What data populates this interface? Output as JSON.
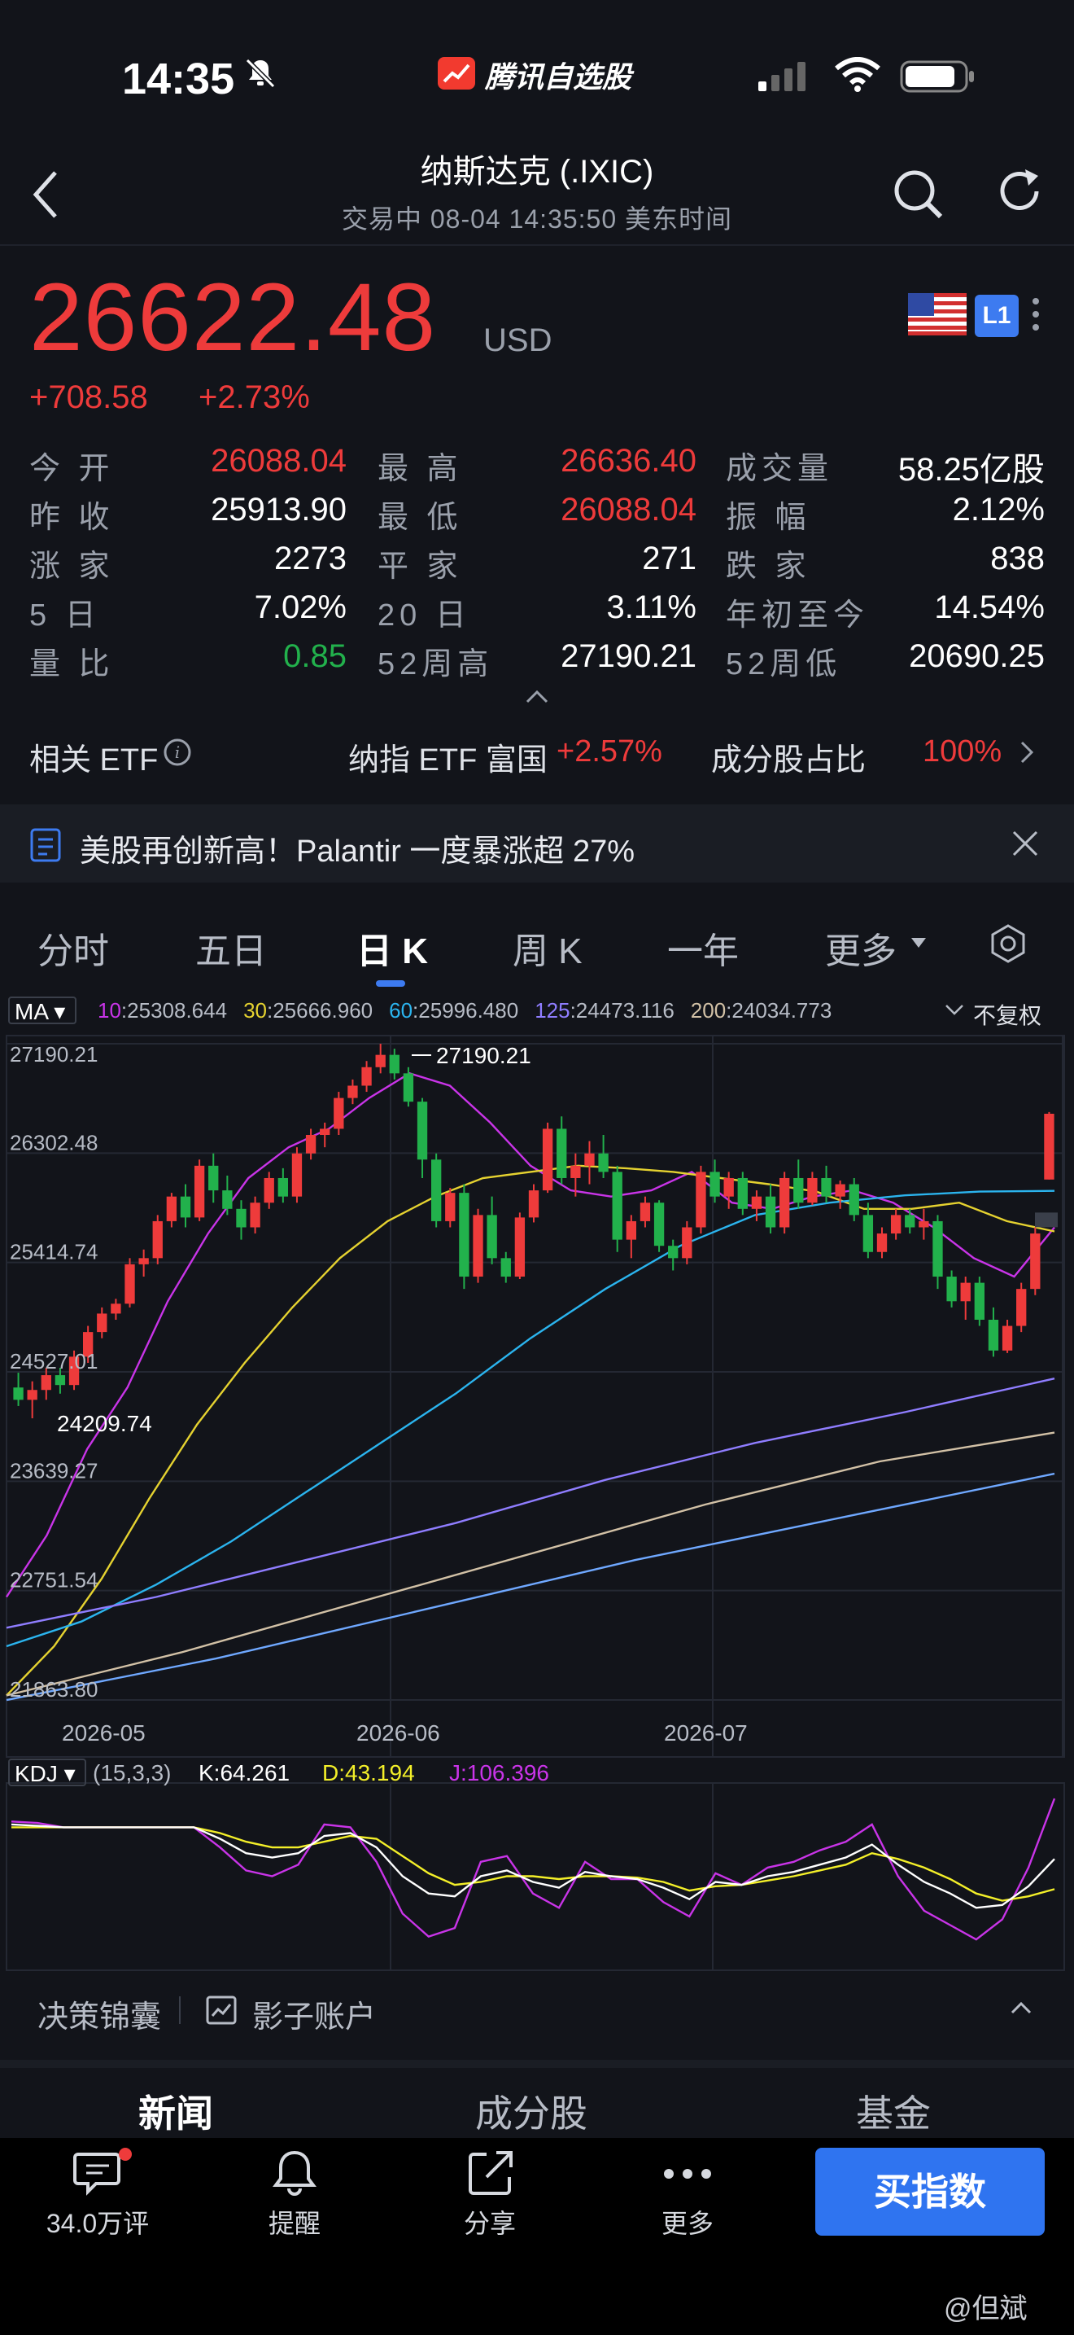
{
  "status_bar": {
    "time": "14:35",
    "app_name": "腾讯自选股"
  },
  "header": {
    "title": "纳斯达克 (.IXIC)",
    "subtitle": "交易中  08-04 14:35:50 美东时间"
  },
  "quote": {
    "price": "26622.48",
    "currency": "USD",
    "change": "+708.58",
    "change_pct": "+2.73%",
    "level_badge": "L1",
    "up_color": "#ee3b3b",
    "down_color": "#22b14c"
  },
  "stats": [
    [
      {
        "label": "今 开",
        "value": "26088.04",
        "color": "red"
      },
      {
        "label": "最 高",
        "value": "26636.40",
        "color": "red"
      },
      {
        "label": "成交量",
        "value": "58.25亿股",
        "color": "white"
      }
    ],
    [
      {
        "label": "昨 收",
        "value": "25913.90",
        "color": "white"
      },
      {
        "label": "最 低",
        "value": "26088.04",
        "color": "red"
      },
      {
        "label": "振 幅",
        "value": "2.12%",
        "color": "white"
      }
    ],
    [
      {
        "label": "涨 家",
        "value": "2273",
        "color": "white"
      },
      {
        "label": "平 家",
        "value": "271",
        "color": "white"
      },
      {
        "label": "跌 家",
        "value": "838",
        "color": "white"
      }
    ],
    [
      {
        "label": "5 日",
        "value": "7.02%",
        "color": "white"
      },
      {
        "label": "20 日",
        "value": "3.11%",
        "color": "white"
      },
      {
        "label": "年初至今",
        "value": "14.54%",
        "color": "white"
      }
    ],
    [
      {
        "label": "量 比",
        "value": "0.85",
        "color": "green"
      },
      {
        "label": "52周高",
        "value": "27190.21",
        "color": "white"
      },
      {
        "label": "52周低",
        "value": "20690.25",
        "color": "white"
      }
    ]
  ],
  "etf": {
    "label": "相关 ETF",
    "fund": "纳指 ETF 富国",
    "fund_change": "+2.57%",
    "component_label": "成分股占比",
    "component_value": "100%"
  },
  "news_banner": {
    "text": "美股再创新高！Palantir 一度暴涨超 27%"
  },
  "tabs": [
    "分时",
    "五日",
    "日 K",
    "周 K",
    "一年",
    "更多"
  ],
  "active_tab": 2,
  "ma_bar": {
    "button": "MA",
    "items": [
      {
        "label": "10",
        "value": "25308.644",
        "color": "#c934e8"
      },
      {
        "label": "30",
        "value": "25666.960",
        "color": "#e5d230"
      },
      {
        "label": "60",
        "value": "25996.480",
        "color": "#2bb4ee"
      },
      {
        "label": "125",
        "value": "24473.116",
        "color": "#8f7dff"
      },
      {
        "label": "200",
        "value": "24034.773",
        "color": "#d2c1a6"
      }
    ],
    "adjust": "不复权"
  },
  "chart_data": {
    "type": "candlestick",
    "y_ticks": [
      "27190.21",
      "26302.48",
      "25414.74",
      "24527.01",
      "23639.27",
      "22751.54",
      "21863.80"
    ],
    "ylim": [
      21863.8,
      27190.21
    ],
    "x_ticks": [
      "2026-05",
      "2026-06",
      "2026-07"
    ],
    "annotations": [
      {
        "label": "27190.21"
      },
      {
        "label": "24209.74"
      }
    ],
    "candles": [
      [
        24400,
        24520,
        24250,
        24300
      ],
      [
        24300,
        24450,
        24150,
        24380
      ],
      [
        24380,
        24560,
        24300,
        24500
      ],
      [
        24500,
        24560,
        24350,
        24420
      ],
      [
        24420,
        24700,
        24380,
        24650
      ],
      [
        24650,
        24900,
        24600,
        24850
      ],
      [
        24850,
        25050,
        24800,
        25000
      ],
      [
        25000,
        25120,
        24950,
        25080
      ],
      [
        25080,
        25450,
        25050,
        25400
      ],
      [
        25400,
        25520,
        25300,
        25450
      ],
      [
        25450,
        25800,
        25400,
        25750
      ],
      [
        25750,
        25980,
        25700,
        25950
      ],
      [
        25950,
        26050,
        25700,
        25780
      ],
      [
        25780,
        26250,
        25750,
        26200
      ],
      [
        26200,
        26300,
        25900,
        26000
      ],
      [
        26000,
        26120,
        25800,
        25850
      ],
      [
        25850,
        25920,
        25600,
        25700
      ],
      [
        25700,
        25950,
        25650,
        25900
      ],
      [
        25900,
        26150,
        25850,
        26100
      ],
      [
        26100,
        26180,
        25900,
        25950
      ],
      [
        25950,
        26350,
        25900,
        26300
      ],
      [
        26300,
        26500,
        26250,
        26450
      ],
      [
        26450,
        26550,
        26350,
        26500
      ],
      [
        26500,
        26800,
        26450,
        26750
      ],
      [
        26750,
        26900,
        26700,
        26850
      ],
      [
        26850,
        27050,
        26800,
        27000
      ],
      [
        27000,
        27190,
        26950,
        27100
      ],
      [
        27100,
        27150,
        26900,
        26950
      ],
      [
        26950,
        27000,
        26680,
        26720
      ],
      [
        26720,
        26750,
        26100,
        26250
      ],
      [
        26250,
        26300,
        25700,
        25750
      ],
      [
        25750,
        26020,
        25700,
        25980
      ],
      [
        25980,
        26050,
        25200,
        25300
      ],
      [
        25300,
        25850,
        25250,
        25800
      ],
      [
        25800,
        25950,
        25400,
        25450
      ],
      [
        25450,
        25500,
        25250,
        25300
      ],
      [
        25300,
        25820,
        25280,
        25780
      ],
      [
        25780,
        26050,
        25740,
        26000
      ],
      [
        26000,
        26550,
        25980,
        26500
      ],
      [
        26500,
        26600,
        26050,
        26100
      ],
      [
        26100,
        26300,
        25950,
        26200
      ],
      [
        26200,
        26400,
        26050,
        26300
      ],
      [
        26300,
        26450,
        26100,
        26150
      ],
      [
        26150,
        26200,
        25500,
        25600
      ],
      [
        25600,
        25800,
        25450,
        25750
      ],
      [
        25750,
        25950,
        25700,
        25900
      ],
      [
        25900,
        25920,
        25500,
        25550
      ],
      [
        25550,
        25600,
        25350,
        25450
      ],
      [
        25450,
        25750,
        25400,
        25700
      ],
      [
        25700,
        26200,
        25650,
        26150
      ],
      [
        26150,
        26250,
        25900,
        25950
      ],
      [
        25950,
        26150,
        25850,
        26100
      ],
      [
        26100,
        26150,
        25800,
        25850
      ],
      [
        25850,
        26000,
        25750,
        25950
      ],
      [
        25950,
        26050,
        25650,
        25700
      ],
      [
        25700,
        26150,
        25650,
        26100
      ],
      [
        26100,
        26250,
        25850,
        25900
      ],
      [
        25900,
        26150,
        25880,
        26100
      ],
      [
        26100,
        26200,
        25900,
        25950
      ],
      [
        25950,
        26080,
        25850,
        26050
      ],
      [
        26050,
        26100,
        25750,
        25800
      ],
      [
        25800,
        25900,
        25450,
        25500
      ],
      [
        25500,
        25700,
        25450,
        25650
      ],
      [
        25650,
        25850,
        25600,
        25800
      ],
      [
        25800,
        25850,
        25650,
        25700
      ],
      [
        25700,
        25850,
        25600,
        25750
      ],
      [
        25750,
        25800,
        25200,
        25300
      ],
      [
        25300,
        25350,
        25050,
        25100
      ],
      [
        25100,
        25300,
        24950,
        25250
      ],
      [
        25250,
        25300,
        24900,
        24950
      ],
      [
        24950,
        25050,
        24650,
        24700
      ],
      [
        24700,
        24950,
        24680,
        24900
      ],
      [
        24900,
        25250,
        24850,
        25200
      ],
      [
        25200,
        25700,
        25150,
        25650
      ],
      [
        26088,
        26636,
        26088,
        26622
      ]
    ],
    "ma_series": [
      {
        "name": "10",
        "color": "#c934e8",
        "start": 25800,
        "points": [
          22700,
          23200,
          23900,
          24400,
          25100,
          25650,
          26100,
          26350,
          26500,
          26750,
          26950,
          26850,
          26550,
          26200,
          26000,
          25950,
          26000,
          26150,
          25900,
          25850,
          25950,
          26000,
          25900,
          25700,
          25450,
          25300,
          25700
        ]
      },
      {
        "name": "30",
        "color": "#e5d230",
        "points": [
          21900,
          22300,
          22850,
          23500,
          24100,
          24600,
          25050,
          25450,
          25750,
          25950,
          26100,
          26150,
          26200,
          26180,
          26150,
          26100,
          26050,
          25990,
          25850,
          25850,
          25900,
          25750,
          25667
        ]
      },
      {
        "name": "60",
        "color": "#2bb4ee",
        "points": [
          22300,
          22500,
          22800,
          23150,
          23550,
          23950,
          24350,
          24800,
          25200,
          25550,
          25800,
          25900,
          25960,
          25990,
          25996
        ]
      },
      {
        "name": "125",
        "color": "#8f7dff",
        "points": [
          22450,
          22700,
          23000,
          23300,
          23650,
          23950,
          24200,
          24473
        ]
      },
      {
        "name": "200",
        "color": "#d2c1a6",
        "points": [
          21900,
          22250,
          22650,
          23050,
          23450,
          23800,
          24034
        ]
      },
      {
        "name": "blue-light",
        "color": "#6fa8ff",
        "points": [
          21863,
          22200,
          22600,
          23000,
          23350,
          23700
        ]
      }
    ]
  },
  "kdj_bar": {
    "button": "KDJ",
    "params": "(15,3,3)",
    "k_label": "K:64.261",
    "d_label": "D:43.194",
    "j_label": "J:106.396",
    "k_color": "#ffffff",
    "d_color": "#f3ef29",
    "j_color": "#c934e8"
  },
  "kdj_data": {
    "K": [
      88,
      87,
      86,
      86,
      86,
      86,
      86,
      86,
      78,
      68,
      65,
      68,
      80,
      82,
      72,
      52,
      40,
      38,
      52,
      56,
      48,
      44,
      55,
      52,
      50,
      44,
      36,
      48,
      46,
      52,
      55,
      60,
      65,
      74,
      60,
      48,
      40,
      30,
      32,
      45,
      64
    ],
    "D": [
      86,
      86,
      86,
      86,
      86,
      86,
      86,
      86,
      82,
      76,
      72,
      72,
      76,
      80,
      78,
      66,
      54,
      46,
      48,
      52,
      52,
      50,
      52,
      52,
      51,
      48,
      42,
      45,
      46,
      49,
      52,
      56,
      60,
      68,
      64,
      58,
      50,
      40,
      35,
      38,
      43
    ],
    "J": [
      90,
      89,
      86,
      86,
      86,
      86,
      86,
      86,
      72,
      56,
      52,
      60,
      88,
      86,
      62,
      26,
      10,
      16,
      62,
      66,
      40,
      30,
      62,
      50,
      50,
      34,
      24,
      54,
      46,
      58,
      62,
      70,
      76,
      88,
      52,
      28,
      18,
      8,
      22,
      58,
      106
    ]
  },
  "tools": {
    "decision": "决策锦囊",
    "shadow": "影子账户"
  },
  "sections": [
    "新闻",
    "成分股",
    "基金"
  ],
  "bottom_nav": [
    {
      "label": "34.0万评",
      "icon": "comment-icon"
    },
    {
      "label": "提醒",
      "icon": "bell-icon"
    },
    {
      "label": "分享",
      "icon": "share-icon"
    },
    {
      "label": "更多",
      "icon": "more-icon"
    }
  ],
  "buy_button": "买指数",
  "watermark": "@但斌"
}
